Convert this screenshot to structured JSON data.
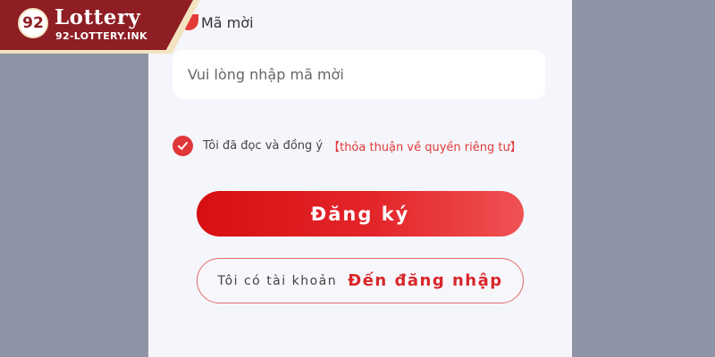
{
  "brand": {
    "emblem": "92",
    "name": "Lottery",
    "domain": "92-LOTTERY.INK"
  },
  "form": {
    "invite_label": "Mã mời",
    "invite_placeholder": "Vui lòng nhập mã mời",
    "agree_text": "Tôi đã đọc và đồng ý",
    "policy_link": "【thỏa thuận về quyền riêng tư】",
    "agree_checked": true,
    "register_label": "Đăng ký",
    "login_prefix": "Tôi có tài khoản",
    "login_action": "Đến đăng nhập"
  },
  "colors": {
    "accent": "#e33a3a",
    "brand": "#8e1d24",
    "background": "#8f93a6",
    "panel": "#f5f6fb"
  },
  "icons": {
    "check": "check-icon"
  }
}
